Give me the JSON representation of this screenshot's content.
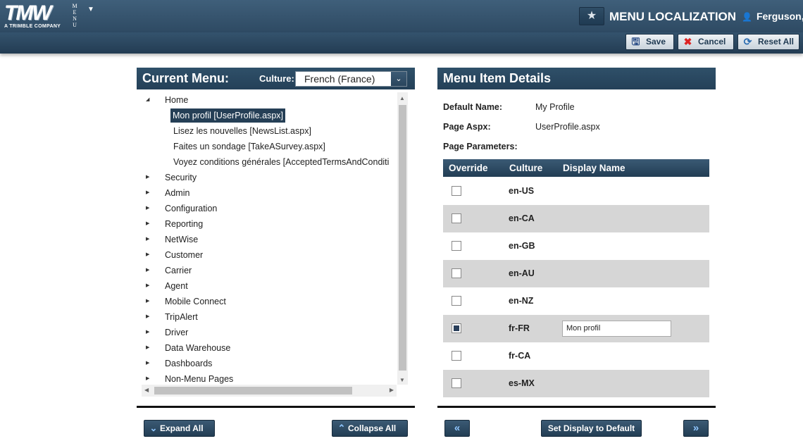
{
  "header": {
    "logo_text": "TMW",
    "logo_subtext": "A TRIMBLE COMPANY",
    "menu_vertical": [
      "M",
      "E",
      "N",
      "U"
    ],
    "page_title": "MENU LOCALIZATION",
    "user_name": "Ferguson,"
  },
  "toolbar": {
    "save_label": "Save",
    "cancel_label": "Cancel",
    "reset_label": "Reset All"
  },
  "left_panel": {
    "title": "Current Menu:",
    "culture_label": "Culture:",
    "culture_value": "French (France)",
    "tree": {
      "home": "Home",
      "home_children": [
        "Mon profil [UserProfile.aspx]",
        "Lisez les nouvelles [NewsList.aspx]",
        "Faites un sondage [TakeASurvey.aspx]",
        "Voyez conditions générales [AcceptedTermsAndConditi"
      ],
      "nodes": [
        "Security",
        "Admin",
        "Configuration",
        "Reporting",
        "NetWise",
        "Customer",
        "Carrier",
        "Agent",
        "Mobile Connect",
        "TripAlert",
        "Driver",
        "Data Warehouse",
        "Dashboards",
        "Non-Menu Pages"
      ]
    },
    "expand_all_label": "Expand All",
    "collapse_all_label": "Collapse All"
  },
  "right_panel": {
    "title": "Menu Item Details",
    "default_name_label": "Default Name:",
    "default_name_value": "My Profile",
    "page_aspx_label": "Page Aspx:",
    "page_aspx_value": "UserProfile.aspx",
    "page_params_label": "Page Parameters:",
    "grid": {
      "columns": [
        "Override",
        "Culture",
        "Display Name"
      ],
      "rows": [
        {
          "override": false,
          "culture": "en-US",
          "display": ""
        },
        {
          "override": false,
          "culture": "en-CA",
          "display": ""
        },
        {
          "override": false,
          "culture": "en-GB",
          "display": ""
        },
        {
          "override": false,
          "culture": "en-AU",
          "display": ""
        },
        {
          "override": false,
          "culture": "en-NZ",
          "display": ""
        },
        {
          "override": true,
          "culture": "fr-FR",
          "display": "Mon profil"
        },
        {
          "override": false,
          "culture": "fr-CA",
          "display": ""
        },
        {
          "override": false,
          "culture": "es-MX",
          "display": ""
        }
      ]
    },
    "set_default_label": "Set Display to Default"
  },
  "colors": {
    "header_bg": "#2e4a63",
    "panel_head": "#2f5069",
    "selected_node": "#253f56",
    "alt_row": "#d6d6d6"
  }
}
